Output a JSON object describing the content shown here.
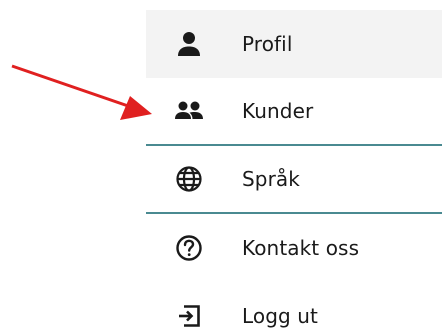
{
  "menu": {
    "items": [
      {
        "label": "Profil",
        "icon": "person-icon"
      },
      {
        "label": "Kunder",
        "icon": "people-icon"
      },
      {
        "label": "Språk",
        "icon": "globe-icon"
      },
      {
        "label": "Kontakt oss",
        "icon": "help-circle-icon"
      },
      {
        "label": "Logg ut",
        "icon": "logout-icon"
      }
    ]
  },
  "colors": {
    "active_bg": "#f3f3f3",
    "separator": "#4a8a91",
    "arrow": "#e02020",
    "icon": "#1a1a1a"
  }
}
